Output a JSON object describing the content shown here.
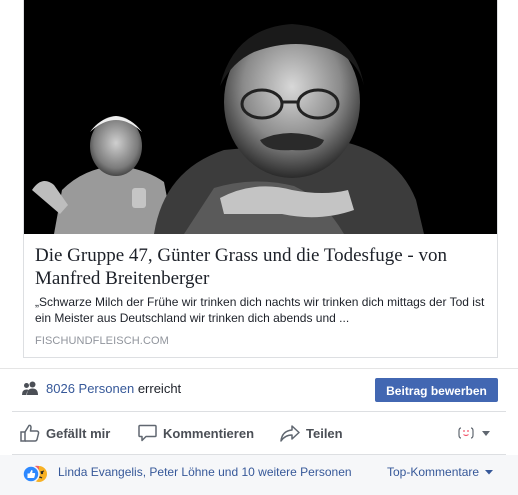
{
  "link_preview": {
    "title": "Die Gruppe 47, Günter Grass und die Todesfuge - von Manfred Breitenberger",
    "description": "„Schwarze Milch der Frühe wir trinken dich nachts wir trinken dich mittags der Tod ist ein Meister aus Deutschland wir trinken dich abends und ...",
    "domain": "FISCHUNDFLEISCH.COM",
    "image_icon": "photo-of-two-elderly-men"
  },
  "reach": {
    "icon": "people-icon",
    "count_label": "8026 Personen",
    "suffix": "erreicht",
    "promote_label": "Beitrag bewerben"
  },
  "actions": {
    "like_label": "Gefällt mir",
    "comment_label": "Kommentieren",
    "share_label": "Teilen",
    "reaction_picker_icon": "reaction-face-icon"
  },
  "reactions": {
    "icons": [
      "like-icon",
      "angry-icon"
    ],
    "summary": "Linda Evangelis, Peter Löhne und 10 weitere Personen",
    "sort_label": "Top-Kommentare"
  },
  "colors": {
    "link": "#365899",
    "button": "#4267b2",
    "background": "#f6f7f9"
  }
}
